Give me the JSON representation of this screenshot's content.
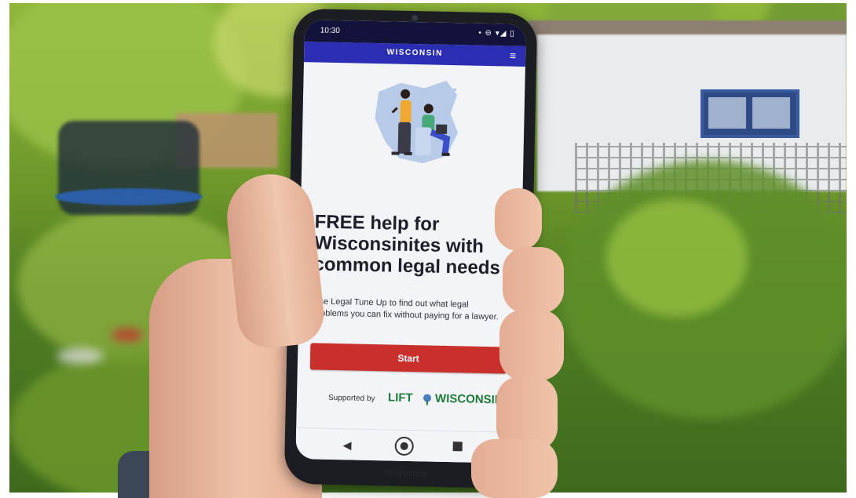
{
  "status": {
    "time": "10:30",
    "icons": "• ⊖ ▾◢ ▯"
  },
  "appbar": {
    "brand": "WISCONSIN",
    "menu_icon": "hamburger-menu-icon"
  },
  "hero": {
    "headline": "FREE help for Wisconsinites with common legal needs",
    "lede": "Use Legal Tune Up to find out what legal problems you can fix without paying for a lawyer.",
    "start_label": "Start"
  },
  "footer": {
    "supported_by": "Supported by",
    "logo_left": "LIFT",
    "logo_right": "WISCONSIN"
  },
  "device": {
    "chin_brand": "motorola"
  },
  "colors": {
    "status_bar": "#12123a",
    "app_bar": "#2b2eb3",
    "start_button": "#c9302c",
    "logo_green": "#1e7a3a",
    "screen_bg": "#f3f4f7"
  },
  "nav_icons": [
    "back-icon",
    "home-icon",
    "recents-icon"
  ]
}
